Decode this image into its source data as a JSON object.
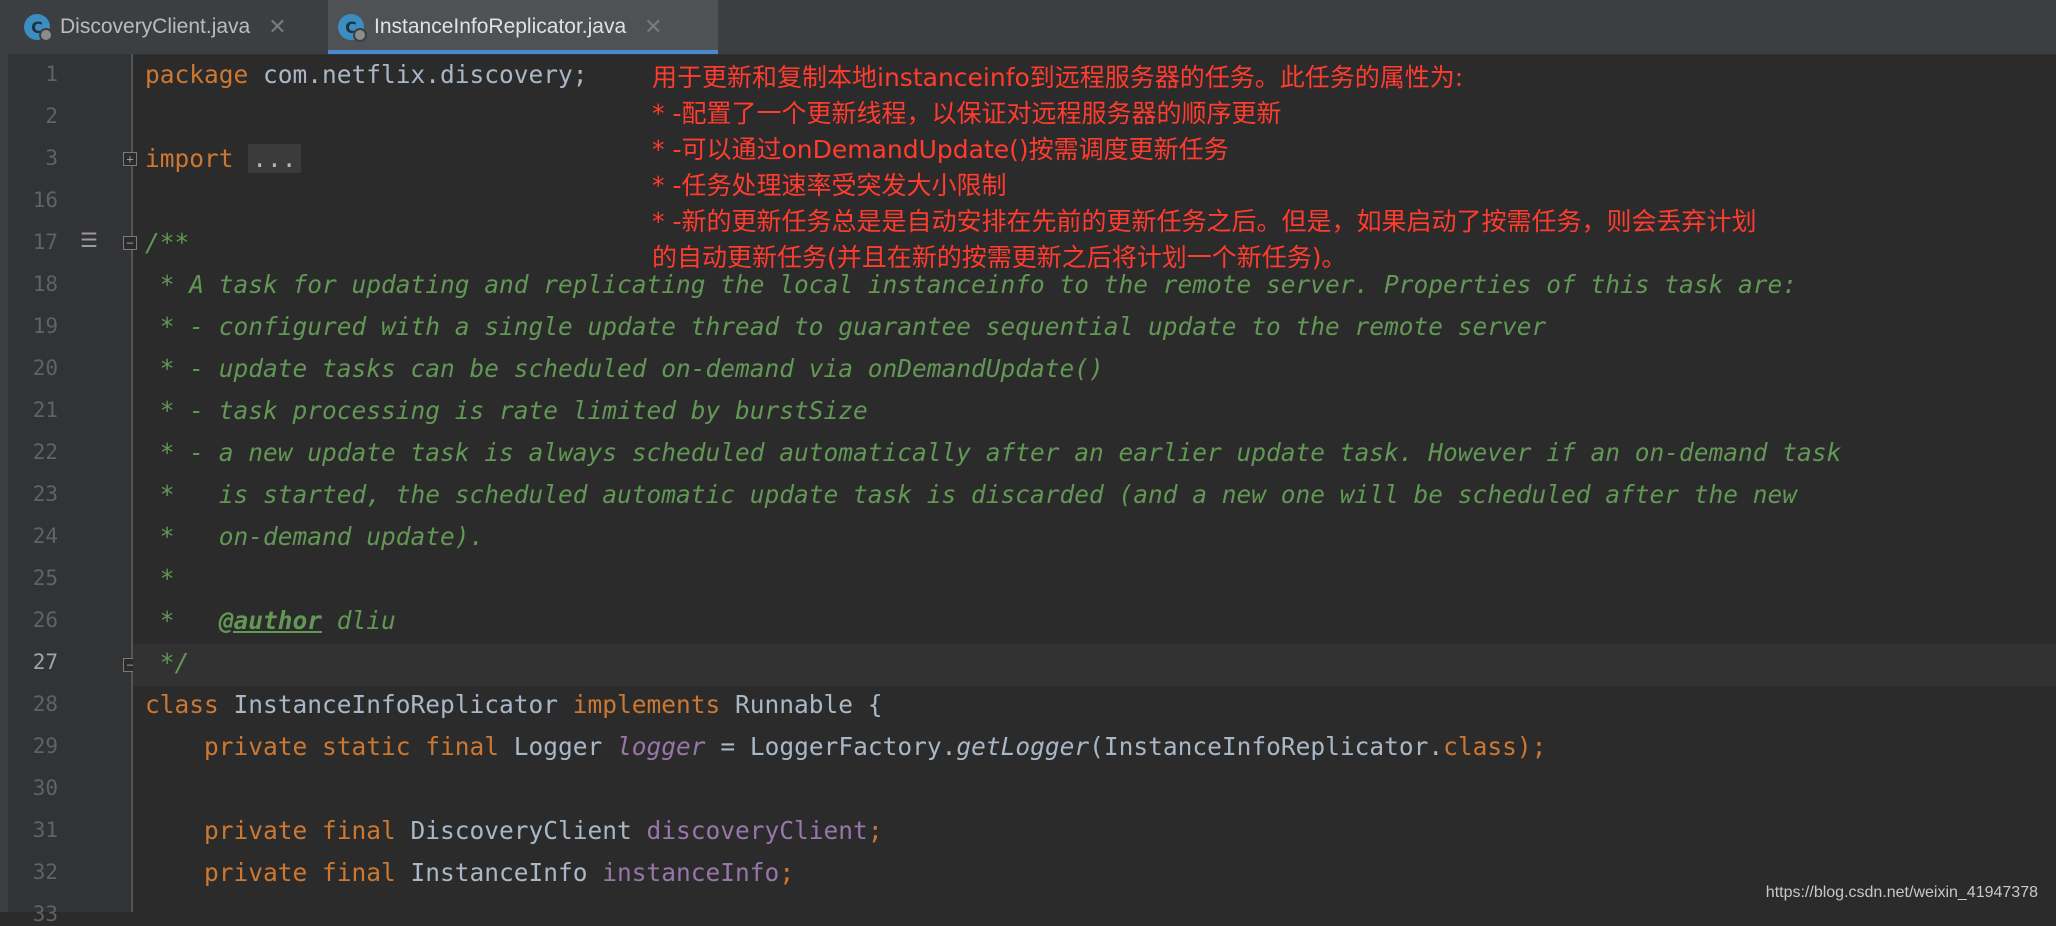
{
  "tabs": [
    {
      "label": "DiscoveryClient.java",
      "icon": "C",
      "active": false
    },
    {
      "label": "InstanceInfoReplicator.java",
      "icon": "C",
      "active": true
    }
  ],
  "line_numbers": [
    "1",
    "2",
    "3",
    "16",
    "17",
    "18",
    "19",
    "20",
    "21",
    "22",
    "23",
    "24",
    "25",
    "26",
    "27",
    "28",
    "29",
    "30",
    "31",
    "32",
    "33"
  ],
  "code": {
    "l1": {
      "kw": "package",
      "rest": " com.netflix.discovery;"
    },
    "l3": {
      "kw": "import",
      "folded": "..."
    },
    "l17": "/**",
    "l18": " * A task for updating and replicating the local instanceinfo to the remote server. Properties of this task are:",
    "l19": " * - configured with a single update thread to guarantee sequential update to the remote server",
    "l20": " * - update tasks can be scheduled on-demand via onDemandUpdate()",
    "l21": " * - task processing is rate limited by burstSize",
    "l22": " * - a new update task is always scheduled automatically after an earlier update task. However if an on-demand task",
    "l23": " *   is started, the scheduled automatic update task is discarded (and a new one will be scheduled after the new",
    "l24": " *   on-demand update).",
    "l25": " *",
    "l26": {
      "prefix": " *   ",
      "tag": "@author",
      "value": " dliu"
    },
    "l27": " */",
    "l28": {
      "kw1": "class",
      "name": " InstanceInfoReplicator ",
      "kw2": "implements",
      "rest": " Runnable {"
    },
    "l29": {
      "indent": "    ",
      "kw": "private static final",
      "type": " Logger ",
      "field": "logger",
      "eq": " = LoggerFactory.",
      "method": "getLogger",
      "args": "(InstanceInfoReplicator.",
      "kw2": "class",
      "end": ");"
    },
    "l31": {
      "indent": "    ",
      "kw": "private final",
      "type": " DiscoveryClient ",
      "field": "discoveryClient",
      "end": ";"
    },
    "l32": {
      "indent": "    ",
      "kw": "private final",
      "type": " InstanceInfo ",
      "field": "instanceInfo",
      "end": ";"
    }
  },
  "annotation": [
    "用于更新和复制本地instanceinfo到远程服务器的任务。此任务的属性为:",
    "* -配置了一个更新线程，以保证对远程服务器的顺序更新",
    "* -可以通过onDemandUpdate()按需调度更新任务",
    "* -任务处理速率受突发大小限制",
    "* -新的更新任务总是是自动安排在先前的更新任务之后。但是，如果启动了按需任务，则会丢弃计划",
    "的自动更新任务(并且在新的按需更新之后将计划一个新任务)。"
  ],
  "watermark": "https://blog.csdn.net/weixin_41947378",
  "colors": {
    "annotation": "#ff3c2e",
    "keyword": "#cc7832",
    "doc": "#629755",
    "field": "#9876aa"
  }
}
